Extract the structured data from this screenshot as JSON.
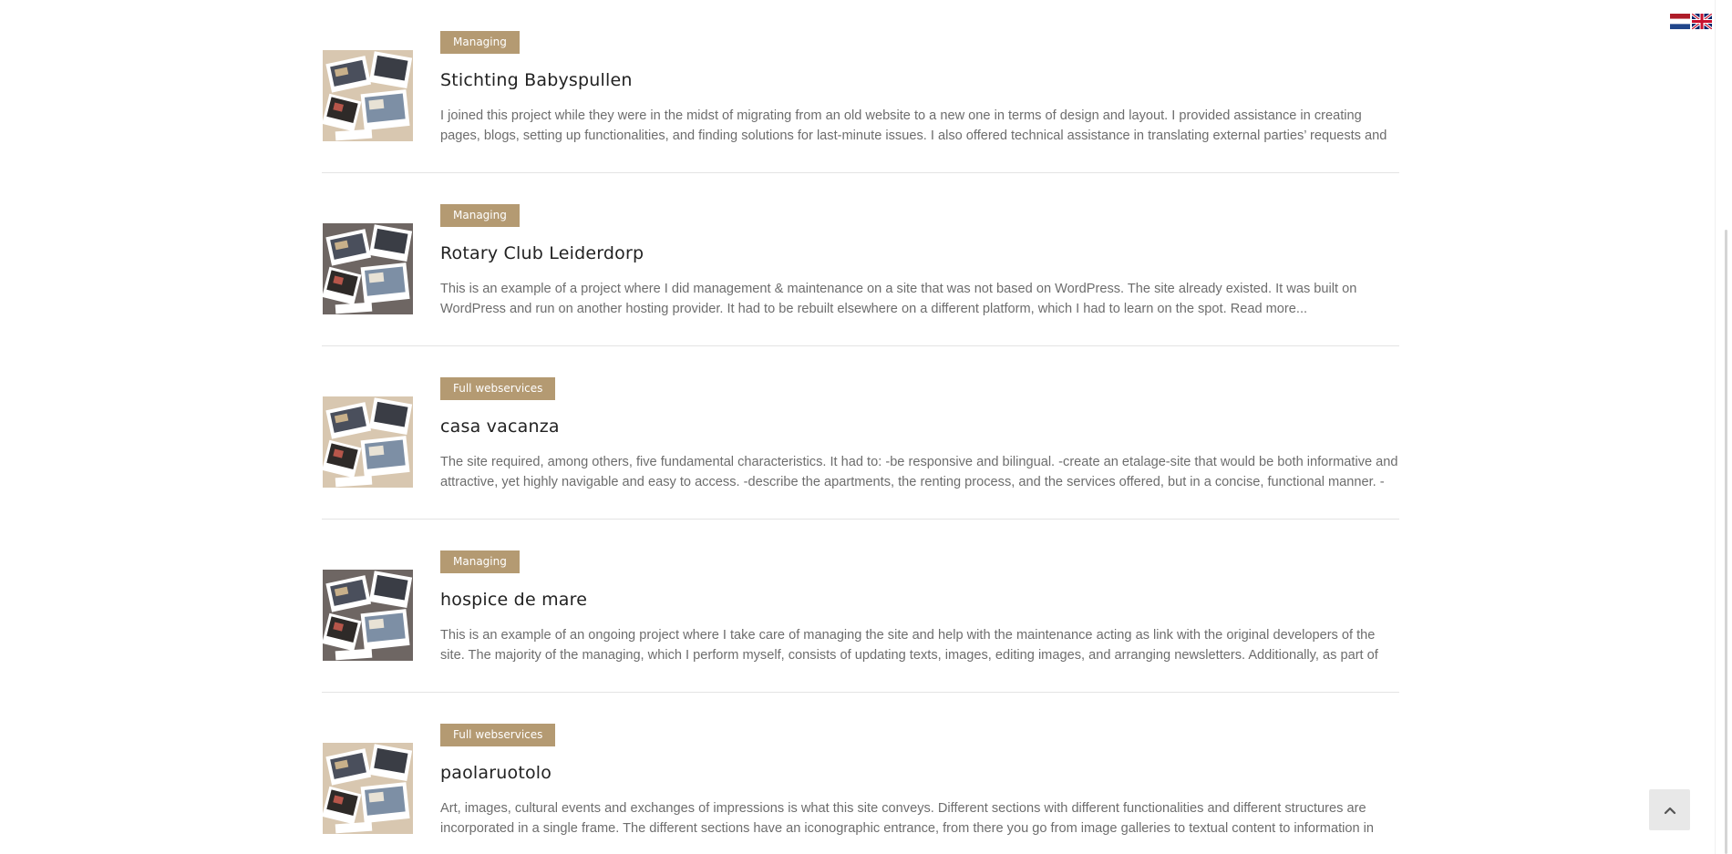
{
  "language_switcher": {
    "flags": [
      {
        "name": "dutch-flag-icon"
      },
      {
        "name": "english-flag-icon"
      }
    ]
  },
  "projects": [
    {
      "category": "Managing",
      "title": "Stichting Babyspullen",
      "excerpt": "I joined this project while they were in the midst of migrating from an old website to a new one in terms of design and layout. I provided assistance in creating pages, blogs, setting up functionalities, and finding solutions for last-minute issues. I also offered technical assistance in translating external parties’ requests and",
      "read_more": "",
      "thumb_bg": "#d8c7b0"
    },
    {
      "category": "Managing",
      "title": "Rotary Club Leiderdorp",
      "excerpt": "This is an example of a project where I did management & maintenance on a site that was not based on WordPress. The site already existed. It was built on WordPress and run on another hosting provider. It had to be rebuilt elsewhere on a different platform, which I had to learn on the spot.",
      "read_more": "Read more...",
      "thumb_bg": "#6e6663"
    },
    {
      "category": "Full webservices",
      "title": "casa vacanza",
      "excerpt": "The site required, among others, five fundamental characteristics. It had to: -be responsive and bilingual. -create an etalage-site that would be both informative and attractive, yet highly navigable and easy to access. -describe the apartments, the renting process, and the services offered, but in a concise, functional manner. -",
      "read_more": "",
      "thumb_bg": "#d8c7b0"
    },
    {
      "category": "Managing",
      "title": "hospice de mare",
      "excerpt": "This is an example of an ongoing project where I take care of managing the site and help with the maintenance acting as link with the original developers of the site. The majority of the managing, which I perform myself, consists of updating texts, images, editing images, and arranging newsletters. Additionally, as part of my",
      "read_more": "",
      "thumb_bg": "#6e6663"
    },
    {
      "category": "Full webservices",
      "title": "paolaruotolo",
      "excerpt": "Art, images, cultural events and exchanges of impressions is what this site conveys. Different sections with different functionalities and different structures are incorporated in a single frame. The different sections have an iconographic entrance, from there you go from image galleries to textual content to information in",
      "read_more": "",
      "thumb_bg": "#d8c7b0"
    }
  ],
  "back_to_top": {
    "icon": "chevron-up-icon"
  }
}
